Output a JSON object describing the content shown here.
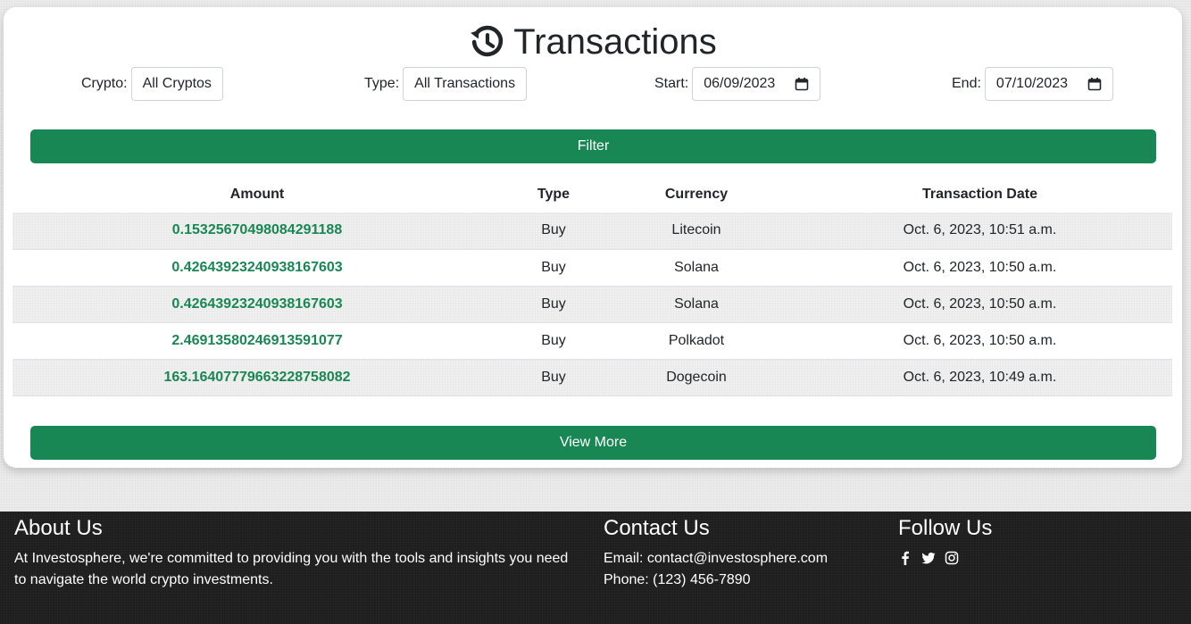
{
  "header": {
    "title": "Transactions",
    "icon": "history-icon"
  },
  "filters": {
    "crypto_label": "Crypto:",
    "crypto_value": "All Cryptos",
    "type_label": "Type:",
    "type_value": "All Transactions",
    "start_label": "Start:",
    "start_value": "06/09/2023",
    "end_label": "End:",
    "end_value": "07/10/2023",
    "filter_button": "Filter"
  },
  "table": {
    "headers": [
      "Amount",
      "Type",
      "Currency",
      "Transaction Date"
    ],
    "rows": [
      {
        "amount": "0.15325670498084291188",
        "type": "Buy",
        "currency": "Litecoin",
        "date": "Oct. 6, 2023, 10:51 a.m."
      },
      {
        "amount": "0.42643923240938167603",
        "type": "Buy",
        "currency": "Solana",
        "date": "Oct. 6, 2023, 10:50 a.m."
      },
      {
        "amount": "0.42643923240938167603",
        "type": "Buy",
        "currency": "Solana",
        "date": "Oct. 6, 2023, 10:50 a.m."
      },
      {
        "amount": "2.46913580246913591077",
        "type": "Buy",
        "currency": "Polkadot",
        "date": "Oct. 6, 2023, 10:50 a.m."
      },
      {
        "amount": "163.16407779663228758082",
        "type": "Buy",
        "currency": "Dogecoin",
        "date": "Oct. 6, 2023, 10:49 a.m."
      }
    ]
  },
  "view_more_button": "View More",
  "footer": {
    "about_title": "About Us",
    "about_text_1": "At Investosphere, we're committed to providing you with the tools and insights you need",
    "about_text_2": "to navigate the world crypto investments.",
    "contact_title": "Contact Us",
    "contact_email": "Email: contact@investosphere.com",
    "contact_phone": "Phone: (123) 456-7890",
    "follow_title": "Follow Us",
    "social_icons": [
      "facebook-icon",
      "twitter-icon",
      "instagram-icon"
    ]
  },
  "colors": {
    "accent": "#198754",
    "footer_bg": "#1e1e1e"
  }
}
